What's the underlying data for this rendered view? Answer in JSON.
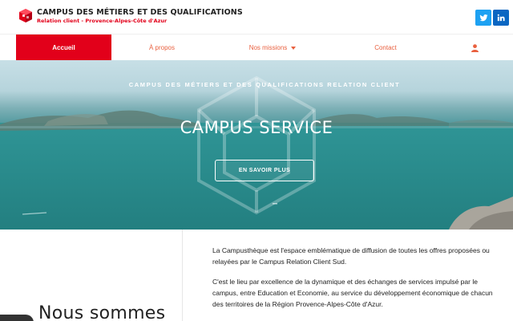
{
  "header": {
    "logo_title": "CAMPUS DES MÉTIERS ET DES QUALIFICATIONS",
    "logo_subtitle": "Relation client - Provence-Alpes-Côte d'Azur",
    "social": {
      "twitter_icon": "twitter-icon",
      "linkedin_icon": "linkedin-icon"
    }
  },
  "nav": {
    "items": [
      {
        "label": "Accueil",
        "active": true
      },
      {
        "label": "À propos"
      },
      {
        "label": "Nos missions",
        "has_dropdown": true
      },
      {
        "label": "Contact"
      }
    ],
    "account_icon": "user-icon"
  },
  "hero": {
    "kicker": "CAMPUS DES MÉTIERS ET DES QUALIFICATIONS RELATION CLIENT",
    "title": "CAMPUS SERVICE",
    "button_label": "EN SAVOIR PLUS"
  },
  "content": {
    "paragraph_1": "La Campusthèque est l'espace emblématique de diffusion de toutes les offres proposées ou relayées par le Campus Relation Client Sud.",
    "paragraph_2": "C'est le lieu par excellence de la dynamique et des échanges de services impulsé par le campus, entre Education et Economie, au service du développement économique de chacun des territoires de la Région Provence-Alpes-Côte d'Azur.",
    "heading": "Nous sommes"
  },
  "colors": {
    "brand_red": "#e2001a",
    "nav_text": "#e9603f",
    "twitter": "#1da1f2",
    "linkedin": "#0a66c2"
  }
}
